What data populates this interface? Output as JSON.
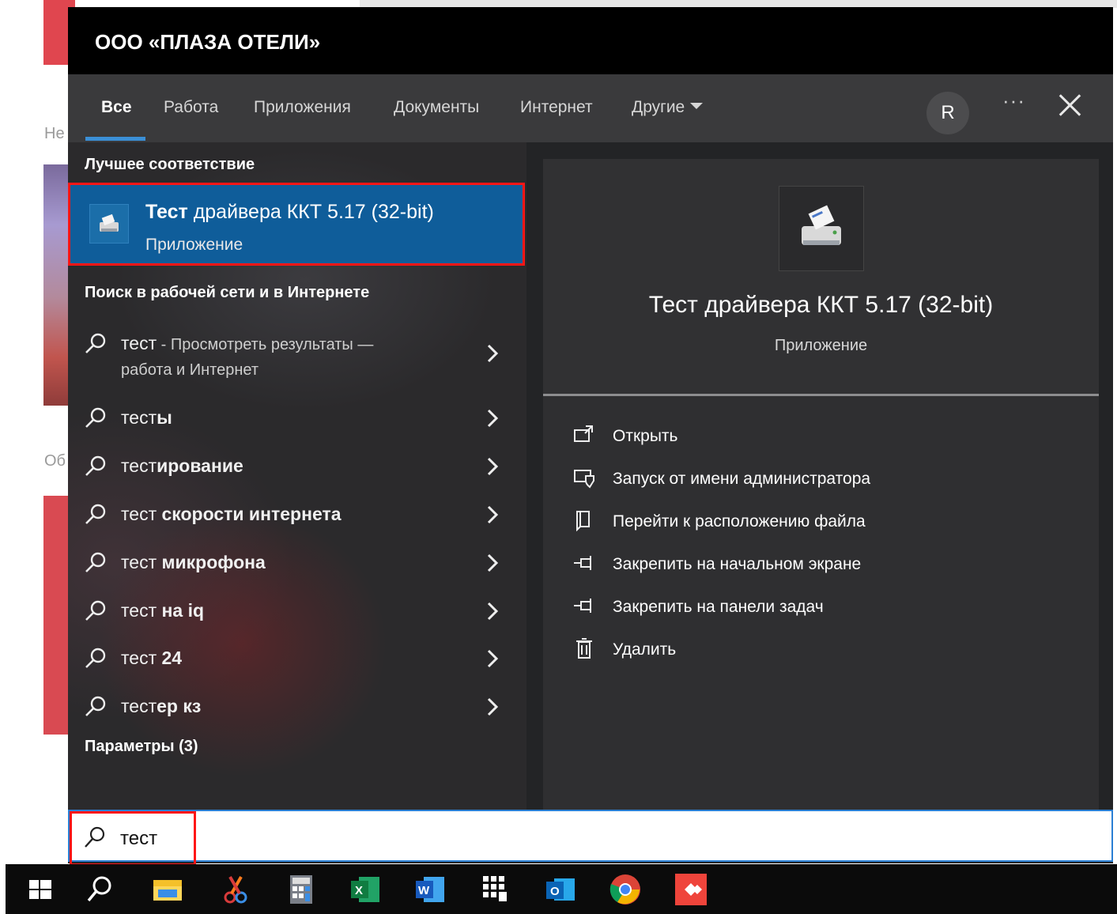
{
  "window": {
    "title": "ООО «ПЛАЗА ОТЕЛИ»"
  },
  "background": {
    "ne_text": "Не",
    "ob_text": "Об"
  },
  "tabs": [
    {
      "label": "Все",
      "active": true
    },
    {
      "label": "Работа"
    },
    {
      "label": "Приложения"
    },
    {
      "label": "Документы"
    },
    {
      "label": "Интернет"
    },
    {
      "label": "Другие"
    }
  ],
  "header": {
    "avatar_letter": "R",
    "more_label": "···"
  },
  "best_match": {
    "heading": "Лучшее соответствие",
    "title_bold": "Тест",
    "title_rest": " драйвера ККТ 5.17 (32-bit)",
    "subtitle": "Приложение"
  },
  "web_search": {
    "heading": "Поиск в рабочей сети и в Интернете",
    "first": {
      "term": "тест",
      "hint": " - Просмотреть результаты —",
      "hint2": "работа и Интернет"
    },
    "items": [
      {
        "plain": "тест",
        "bold": "ы"
      },
      {
        "plain": "тест",
        "bold": "ирование"
      },
      {
        "plain": "тест",
        "bold": " скорости интернета"
      },
      {
        "plain": "тест",
        "bold": " микрофона"
      },
      {
        "plain": "тест",
        "bold": " на iq"
      },
      {
        "plain": "тест",
        "bold": " 24"
      },
      {
        "plain": "тест",
        "bold": "ер кз"
      }
    ]
  },
  "settings": {
    "heading": "Параметры (3)"
  },
  "preview": {
    "title": "Тест драйвера ККТ 5.17 (32-bit)",
    "subtitle": "Приложение",
    "actions": [
      {
        "label": "Открыть",
        "icon": "open-icon"
      },
      {
        "label": "Запуск от имени администратора",
        "icon": "admin-shield-icon"
      },
      {
        "label": "Перейти к расположению файла",
        "icon": "file-location-icon"
      },
      {
        "label": "Закрепить на начальном экране",
        "icon": "pin-start-icon"
      },
      {
        "label": "Закрепить на панели задач",
        "icon": "pin-taskbar-icon"
      },
      {
        "label": "Удалить",
        "icon": "trash-icon"
      }
    ]
  },
  "search": {
    "value": "тест"
  },
  "taskbar": [
    "start-icon",
    "search-icon",
    "file-explorer-icon",
    "snipping-tool-icon",
    "calculator-icon",
    "excel-icon",
    "word-icon",
    "app-grid-icon",
    "outlook-icon",
    "chrome-icon",
    "anydesk-icon"
  ],
  "colors": {
    "accent": "#0f5d9a",
    "highlight": "#ff1616",
    "underline": "#3b8fd6"
  }
}
